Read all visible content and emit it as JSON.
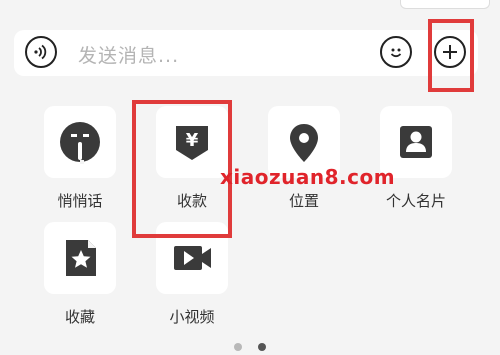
{
  "input_bar": {
    "placeholder": "发送消息..."
  },
  "apps": [
    {
      "label": "悄悄话",
      "icon": "whisper-icon"
    },
    {
      "label": "收款",
      "icon": "receive-money-icon"
    },
    {
      "label": "位置",
      "icon": "location-pin-icon"
    },
    {
      "label": "个人名片",
      "icon": "contact-card-icon"
    },
    {
      "label": "收藏",
      "icon": "favorites-icon"
    },
    {
      "label": "小视频",
      "icon": "video-camera-icon"
    }
  ],
  "watermark": "xiaozuan8.com",
  "pagination": {
    "current": 1,
    "total": 2
  },
  "colors": {
    "highlight": "#e03b3b",
    "watermark": "#e0242b",
    "icon": "#3a3a3a"
  }
}
